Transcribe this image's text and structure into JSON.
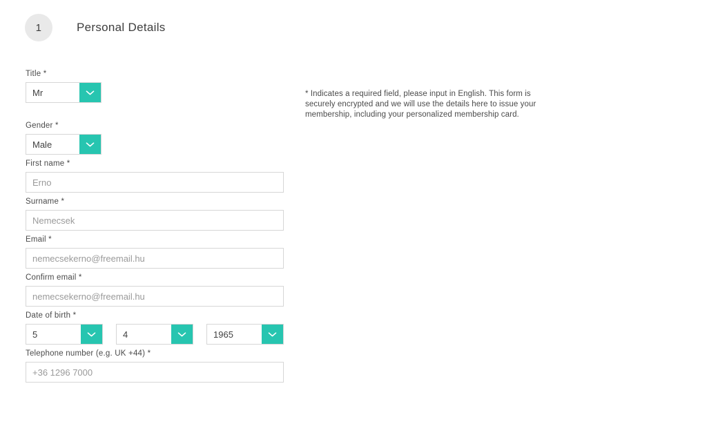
{
  "header": {
    "step_number": "1",
    "title": "Personal Details"
  },
  "note": {
    "text": "* Indicates a required field, please input in English. This form is securely encrypted and we will use the details here to issue your membership, including your personalized membership card."
  },
  "colors": {
    "accent": "#27c5b0",
    "badge_background": "#e9e9e9",
    "input_border": "#d6d6d6",
    "label_text": "#4a4a4a",
    "placeholder_text": "#9a9a9a",
    "page_background": "#ffffff"
  },
  "form": {
    "title_field": {
      "label": "Title *",
      "value": "Mr",
      "icon": "chevron-down-icon"
    },
    "gender_field": {
      "label": "Gender *",
      "value": "Male",
      "icon": "chevron-down-icon"
    },
    "first_name": {
      "label": "First name *",
      "placeholder": "Erno",
      "value": ""
    },
    "surname": {
      "label": "Surname *",
      "placeholder": "Nemecsek",
      "value": ""
    },
    "email": {
      "label": "Email *",
      "placeholder": "nemecsekerno@freemail.hu",
      "value": ""
    },
    "confirm_email": {
      "label": "Confirm email *",
      "placeholder": "nemecsekerno@freemail.hu",
      "value": ""
    },
    "date_of_birth": {
      "label": "Date of birth *",
      "day": "5",
      "month": "4",
      "year": "1965",
      "icon": "chevron-down-icon"
    },
    "telephone": {
      "label": "Telephone number (e.g. UK +44) *",
      "placeholder": "+36 1296 7000",
      "value": ""
    }
  }
}
